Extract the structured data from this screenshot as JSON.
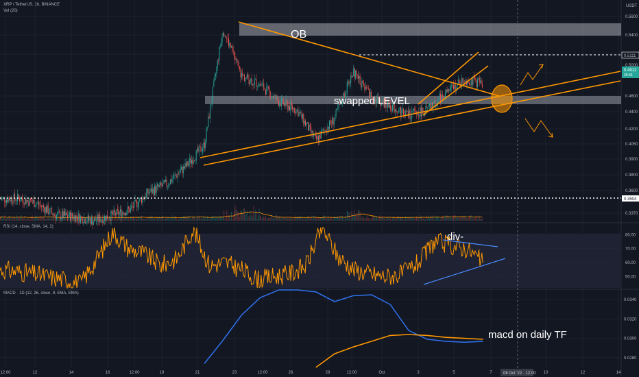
{
  "header": {
    "symbol_line": "XRP / TetherUS, 1h, BINANCE",
    "volume_label": "Vol (20)",
    "rsi_label": "RSI (14, close, SMA, 14, 2)",
    "macd_label": "MACD · 1D (12, 26, close, 9, EMA, EMA)"
  },
  "price_axis": {
    "currency": "USDT",
    "ticks": [
      "0.5600",
      "0.5400",
      "0.5200",
      "0.5000",
      "0.4600",
      "0.4400",
      "0.4200",
      "0.4050",
      "0.3900",
      "0.3800",
      "0.3600",
      "0.3370"
    ],
    "level_upper": "0.5111",
    "last_price": "0.4912",
    "countdown": "25:46",
    "level_lower": "0.3504"
  },
  "rsi_axis": {
    "ticks": [
      "80.00",
      "70.00",
      "60.00",
      "50.00"
    ]
  },
  "macd_axis": {
    "ticks": [
      "0.0340",
      "0.0320",
      "0.0300",
      "0.0280"
    ]
  },
  "time_axis": {
    "ticks": [
      "12:00",
      "12",
      "14",
      "16",
      "12:00",
      "19",
      "21",
      "23",
      "12:00",
      "26",
      "28",
      "12:00",
      "Oct",
      "3",
      "5",
      "7",
      "10",
      "12",
      "14"
    ],
    "cursor_label": "08 Oct '22 · 12:00"
  },
  "annotations": {
    "ob": "OB",
    "swapped": "swapped LEVEL",
    "div": "div-",
    "macd_note": "macd on daily TF"
  },
  "colors": {
    "background": "#131722",
    "candle_up": "#26a69a",
    "candle_down": "#ef5350",
    "trendline": "#ff9800",
    "rsi_line": "#ff9800",
    "macd_line": "#2962ff",
    "signal_line": "#ff9800",
    "zone": "#d1d4dc"
  },
  "chart_data": [
    {
      "type": "candlestick",
      "title": "XRP / TetherUS, 1h, BINANCE",
      "ylim": [
        0.332,
        0.572
      ],
      "x_range": [
        "Sep 11",
        "Oct 15"
      ],
      "close_path": [
        [
          "Sep 11",
          0.357
        ],
        [
          "Sep 12",
          0.358
        ],
        [
          "Sep 13",
          0.352
        ],
        [
          "Sep 14",
          0.338
        ],
        [
          "Sep 15",
          0.337
        ],
        [
          "Sep 16",
          0.332
        ],
        [
          "Sep 17",
          0.338
        ],
        [
          "Sep 18",
          0.345
        ],
        [
          "Sep 19",
          0.365
        ],
        [
          "Sep 20",
          0.375
        ],
        [
          "Sep 21",
          0.395
        ],
        [
          "Sep 22",
          0.42
        ],
        [
          "Sep 23",
          0.555
        ],
        [
          "Sep 24",
          0.5
        ],
        [
          "Sep 25",
          0.49
        ],
        [
          "Sep 26",
          0.47
        ],
        [
          "Sep 27",
          0.46
        ],
        [
          "Sep 28",
          0.425
        ],
        [
          "Sep 29",
          0.45
        ],
        [
          "Sep 30",
          0.505
        ],
        [
          "Oct 1",
          0.475
        ],
        [
          "Oct 2",
          0.465
        ],
        [
          "Oct 3",
          0.455
        ],
        [
          "Oct 4",
          0.46
        ],
        [
          "Oct 5",
          0.48
        ],
        [
          "Oct 6",
          0.495
        ],
        [
          "Oct 7",
          0.4912
        ]
      ],
      "last_price": 0.4912,
      "levels": [
        0.5111,
        0.3504
      ]
    },
    {
      "type": "line",
      "title": "RSI (14, close, SMA, 14, 2)",
      "ylim": [
        42,
        86
      ],
      "gridlines": [
        80,
        70,
        60,
        50
      ],
      "series": [
        {
          "values": [
            55,
            54,
            52,
            50,
            48,
            45,
            62,
            82,
            70,
            66,
            58,
            63,
            84,
            58,
            60,
            55,
            48,
            50,
            52,
            58,
            85,
            64,
            55,
            52,
            50,
            52,
            60,
            75,
            72,
            70,
            60
          ]
        }
      ]
    },
    {
      "type": "line",
      "title": "MACD · 1D (12, 26, close, 9, EMA, EMA)",
      "ylim": [
        0.027,
        0.035
      ],
      "gridlines": [
        0.034,
        0.032,
        0.03,
        0.028
      ],
      "series": [
        {
          "points": [
            [
              "Sep 22",
              0.0274
            ],
            [
              "Sep 23",
              0.0298
            ],
            [
              "Sep 24",
              0.0324
            ],
            [
              "Sep 25",
              0.0342
            ],
            [
              "Sep 26",
              0.0352
            ],
            [
              "Sep 27",
              0.0355
            ],
            [
              "Sep 28",
              0.0348
            ],
            [
              "Sep 29",
              0.0338
            ],
            [
              "Sep 30",
              0.0344
            ],
            [
              "Oct 1",
              0.0345
            ],
            [
              "Oct 2",
              0.0335
            ],
            [
              "Oct 3",
              0.0308
            ],
            [
              "Oct 4",
              0.0299
            ],
            [
              "Oct 5",
              0.0297
            ],
            [
              "Oct 6",
              0.0296
            ],
            [
              "Oct 7",
              0.0297
            ]
          ]
        },
        {
          "points": [
            [
              "Sep 28",
              0.027
            ],
            [
              "Sep 29",
              0.0284
            ],
            [
              "Sep 30",
              0.0291
            ],
            [
              "Oct 1",
              0.0297
            ],
            [
              "Oct 2",
              0.0303
            ],
            [
              "Oct 3",
              0.0304
            ],
            [
              "Oct 4",
              0.0303
            ],
            [
              "Oct 5",
              0.0301
            ],
            [
              "Oct 6",
              0.03
            ],
            [
              "Oct 7",
              0.0299
            ]
          ]
        }
      ]
    }
  ]
}
